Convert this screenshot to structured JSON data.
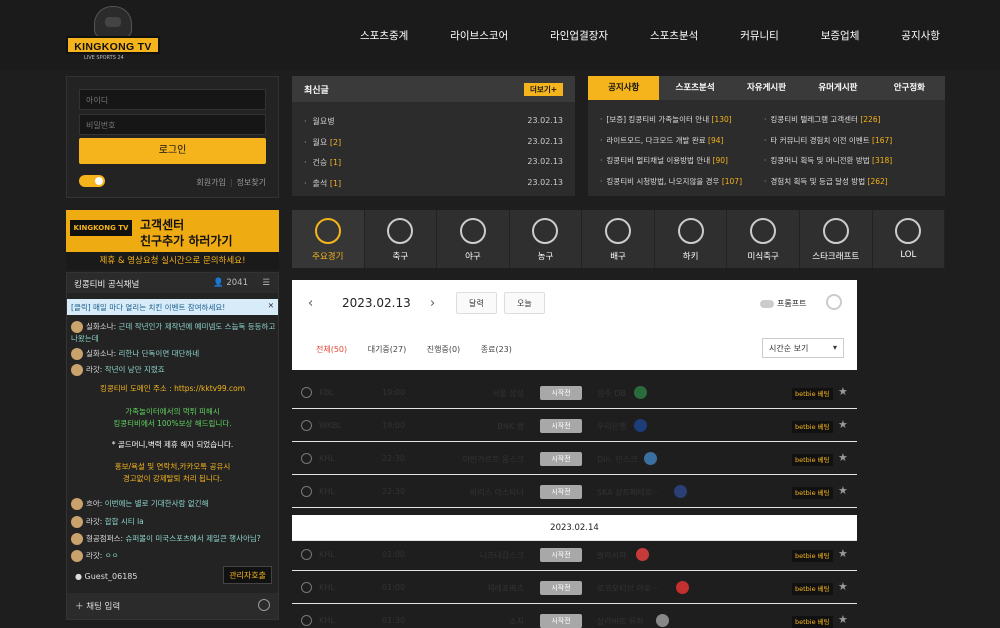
{
  "logo": {
    "word": "KINGKONG TV",
    "sub": "LIVE SPORTS 24"
  },
  "nav": [
    "스포츠중계",
    "라이브스코어",
    "라인업결장자",
    "스포츠분석",
    "커뮤니티",
    "보증업체",
    "공지사항"
  ],
  "login": {
    "id_placeholder": "아이디",
    "pw_placeholder": "비밀번호",
    "button": "로그인",
    "signup": "회원가입",
    "find": "정보찾기"
  },
  "banner": {
    "badge": "KINGKONG TV",
    "line1": "고객센터",
    "line2": "친구추가 하러가기",
    "line3": "제휴 & 영상요청 실시간으로 문의하세요!"
  },
  "chat": {
    "title": "킹콩티비 공식채널",
    "count": "2041",
    "notice": "[클릭] 매일 마다 열리는 치킨 이벤트 참여하세요!",
    "messages": [
      {
        "user": "실화소나:",
        "text": "근데 작년인가 제작년에 예미넴도 스눕독 등등하고 나왔는데"
      },
      {
        "user": "실화소나:",
        "text": "리한나 단독이면 대단하네"
      },
      {
        "user": "라갓:",
        "text": "작년이 낭만 지렸죠"
      }
    ],
    "sys1": "킹콩티비 도메인 주소 : https://kktv99.com",
    "sys2a": "가족놀이터에서의 먹튀 피해시",
    "sys2b": "킹콩티비에서 100%보상 해드립니다.",
    "sys3": "* 골드머니,벽력 제휴 해지 되었습니다.",
    "sys4a": "홍보/욕설 및 연락처,카카오톡 공유시",
    "sys4b": "경고없이 강제탈퇴 처리 됩니다.",
    "messages2": [
      {
        "user": "흐아:",
        "text": "이번에는 별로 기대한사람 없긴해"
      },
      {
        "user": "라갓:",
        "text": "합합 시티 la"
      },
      {
        "user": "형공점퍼스:",
        "text": "슈퍼볼이 미국스포츠에서 제일큰 행사아님?"
      },
      {
        "user": "라갓:",
        "text": "ㅇㅇ"
      }
    ],
    "guest": "Guest_06185",
    "admin": "관리자호출",
    "input": "채팅 입력"
  },
  "latest": {
    "title": "최신글",
    "more": "더보기+",
    "rows": [
      {
        "t": "월요병",
        "c": "",
        "d": "23.02.13"
      },
      {
        "t": "월요",
        "c": "[2]",
        "d": "23.02.13"
      },
      {
        "t": "건승",
        "c": "[1]",
        "d": "23.02.13"
      },
      {
        "t": "출석",
        "c": "[1]",
        "d": "23.02.13"
      }
    ]
  },
  "board": {
    "tabs": [
      "공지사항",
      "스포츠분석",
      "자유게시판",
      "유머게시판",
      "안구정화"
    ],
    "left": [
      {
        "t": "[보증] 킹콩티비 가족놀이터 안내",
        "c": "[130]"
      },
      {
        "t": "라이트모드, 다크모드 개발 완료",
        "c": "[94]"
      },
      {
        "t": "킹콩티비 멀티채널 이용방법 안내",
        "c": "[90]"
      },
      {
        "t": "킹콩티비 시청방법, 나오지않을 경우",
        "c": "[107]"
      }
    ],
    "right": [
      {
        "t": "킹콩티비 텔레그램 고객센터",
        "c": "[226]"
      },
      {
        "t": "타 커뮤니티 경험치 이전 이벤트",
        "c": "[167]"
      },
      {
        "t": "킹콩머니 획득 및 머니전환 방법",
        "c": "[318]"
      },
      {
        "t": "경험치 획득 및 등급 달성 방법",
        "c": "[262]"
      }
    ]
  },
  "sports": [
    "주요경기",
    "축구",
    "야구",
    "농구",
    "배구",
    "하키",
    "미식축구",
    "스타크래프트",
    "LOL"
  ],
  "schedule": {
    "date": "2023.02.13",
    "calendar": "달력",
    "today": "오늘",
    "prompt": "프롬프트",
    "filters": [
      "전체(50)",
      "대기중(27)",
      "진행중(0)",
      "종료(23)"
    ],
    "sort": "시간순 보기"
  },
  "games": [
    {
      "league": "KBL",
      "time": "19:00",
      "home": "서울 삼성",
      "status": "시작전",
      "away": "원주 DB"
    },
    {
      "league": "WKBL",
      "time": "19:00",
      "home": "BNK 썸",
      "status": "시작전",
      "away": "우리은행"
    },
    {
      "league": "KHL",
      "time": "22:30",
      "home": "아반가르트 옴스크",
      "status": "시작전",
      "away": "Din. 민스크"
    },
    {
      "league": "KHL",
      "time": "22:30",
      "home": "바리스 아스타나",
      "status": "시작전",
      "away": "SKA 상트페테르···"
    }
  ],
  "day2": "2023.02.14",
  "games2": [
    {
      "league": "KHL",
      "time": "01:00",
      "home": "니즈네캄스크",
      "status": "시작전",
      "away": "발라시하"
    },
    {
      "league": "KHL",
      "time": "01:00",
      "home": "체레포베츠",
      "status": "시작전",
      "away": "로코모티브 야로···"
    },
    {
      "league": "KHL",
      "time": "01:30",
      "home": "소치",
      "status": "시작전",
      "away": "살라바트 유파"
    }
  ],
  "betbadge": "betbie 베팅"
}
